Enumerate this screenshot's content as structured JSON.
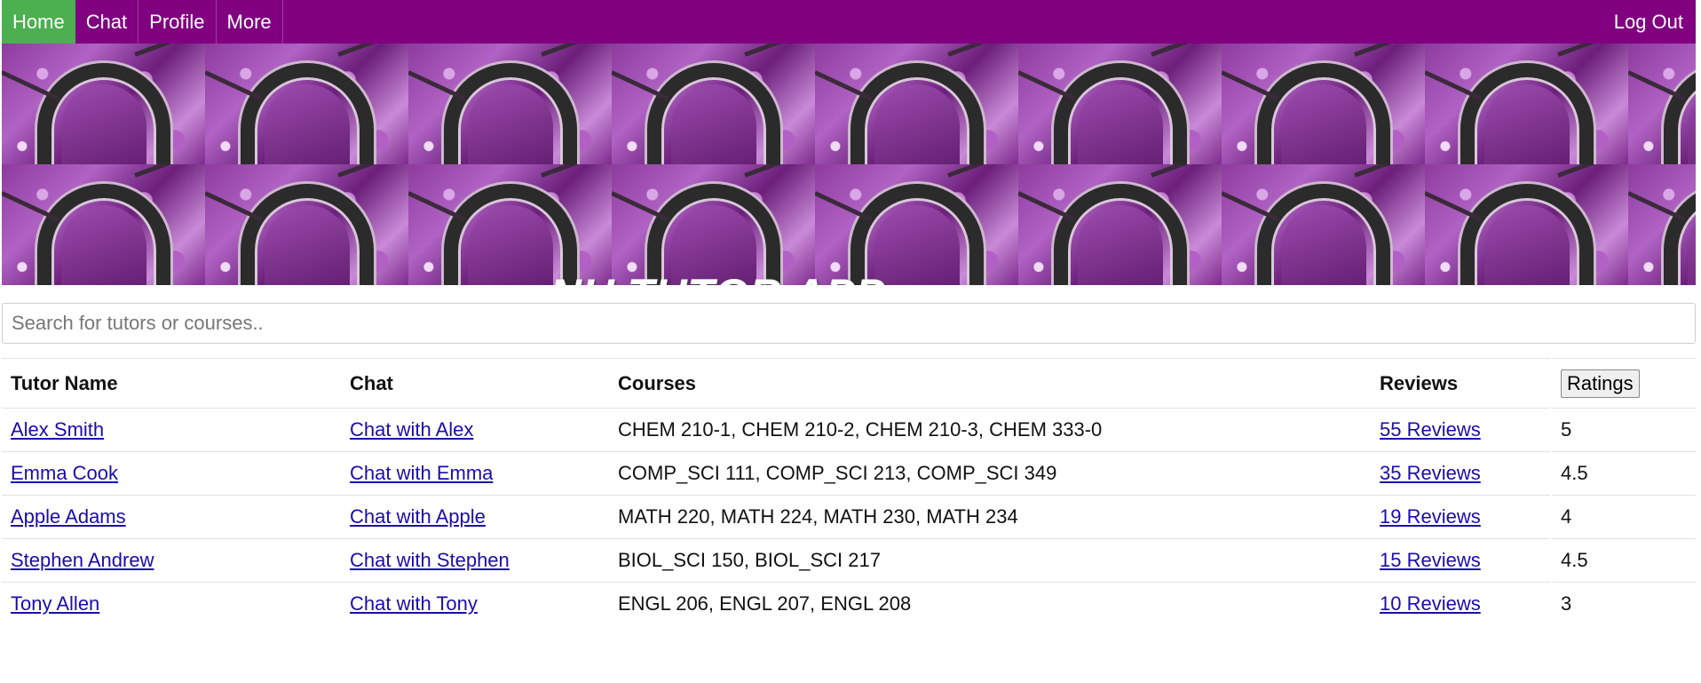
{
  "nav": {
    "items": [
      {
        "label": "Home",
        "active": true
      },
      {
        "label": "Chat",
        "active": false
      },
      {
        "label": "Profile",
        "active": false
      },
      {
        "label": "More",
        "active": false
      }
    ],
    "logout_label": "Log Out"
  },
  "banner": {
    "title": "NU TUTOR APP"
  },
  "search": {
    "placeholder": "Search for tutors or courses..",
    "value": ""
  },
  "table": {
    "headers": {
      "name": "Tutor Name",
      "chat": "Chat",
      "courses": "Courses",
      "reviews": "Reviews",
      "ratings": "Ratings"
    },
    "rows": [
      {
        "name": "Alex Smith",
        "chat": "Chat with Alex",
        "courses": "CHEM 210-1, CHEM 210-2, CHEM 210-3, CHEM 333-0",
        "reviews": "55 Reviews",
        "rating": "5"
      },
      {
        "name": "Emma Cook",
        "chat": "Chat with Emma",
        "courses": "COMP_SCI 111, COMP_SCI 213, COMP_SCI 349",
        "reviews": "35 Reviews",
        "rating": "4.5"
      },
      {
        "name": "Apple Adams",
        "chat": "Chat with Apple",
        "courses": "MATH 220, MATH 224, MATH 230, MATH 234",
        "reviews": "19 Reviews",
        "rating": "4"
      },
      {
        "name": "Stephen Andrew",
        "chat": "Chat with Stephen",
        "courses": "BIOL_SCI 150, BIOL_SCI 217",
        "reviews": "15 Reviews",
        "rating": "4.5"
      },
      {
        "name": "Tony Allen",
        "chat": "Chat with Tony",
        "courses": "ENGL 206, ENGL 207, ENGL 208",
        "reviews": "10 Reviews",
        "rating": "3"
      }
    ]
  },
  "colors": {
    "nav_bg": "#800080",
    "nav_active": "#4caf50",
    "link": "#1a0dab"
  }
}
